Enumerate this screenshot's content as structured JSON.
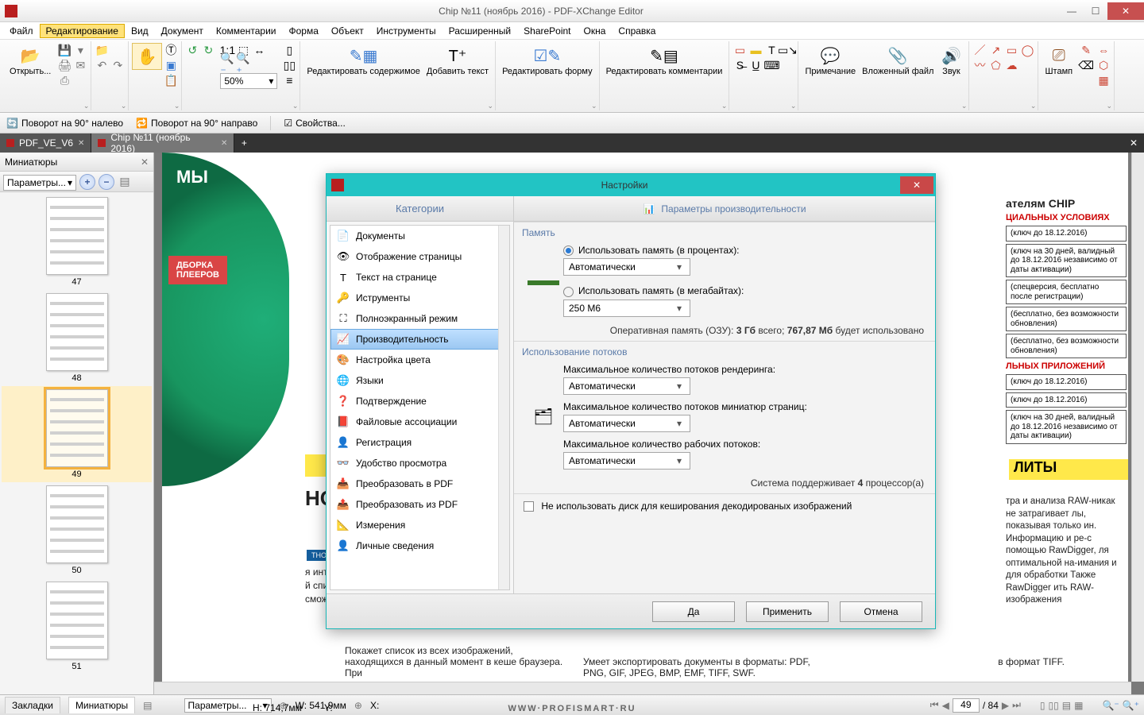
{
  "window": {
    "title": "Chip №11 (ноябрь 2016) - PDF-XChange Editor"
  },
  "menu": [
    "Файл",
    "Редактирование",
    "Вид",
    "Документ",
    "Комментарии",
    "Форма",
    "Объект",
    "Инструменты",
    "Расширенный",
    "SharePoint",
    "Окна",
    "Справка"
  ],
  "menu_active": 1,
  "ribbon": {
    "open": "Открыть...",
    "zoom": "50%",
    "edit_content": "Редактировать содержимое",
    "add_text": "Добавить текст",
    "edit_form": "Редактировать форму",
    "edit_comments": "Редактировать комментарии",
    "note": "Примечание",
    "attach": "Вложенный файл",
    "sound": "Звук",
    "stamp": "Штамп"
  },
  "toolbar2": {
    "rotate_left": "Поворот на 90° налево",
    "rotate_right": "Поворот на 90° направо",
    "properties": "Свойства..."
  },
  "tabs": [
    {
      "label": "PDF_VE_V6"
    },
    {
      "label": "Chip №11 (ноябрь 2016)"
    }
  ],
  "active_tab": 1,
  "thumbs": {
    "title": "Миниатюры",
    "params": "Параметры...",
    "pages": [
      "47",
      "48",
      "49",
      "50",
      "51"
    ],
    "selected": "49"
  },
  "page_content": {
    "chip_readers": "ателям CHIP",
    "special": "ЦИАЛЬНЫХ УСЛОВИЯХ",
    "boxes": [
      "(ключ до 18.12.2016)",
      "(ключ на 30 дней, валидный до 18.12.2016 независимо от даты активации)",
      "(спецверсия, бесплатно после регистрации)",
      "(бесплатно, без возможности обновления)",
      "(бесплатно, без возможности обновления)"
    ],
    "apps": "ЛЬНЫХ ПРИЛОЖЕНИЙ",
    "boxes2": [
      "(ключ до 18.12.2016)",
      "(ключ до 18.12.2016)",
      "(ключ на 30 дней, валидный до 18.12.2016 независимо от даты активации)"
    ],
    "lity": "ЛИТЫ",
    "body1": "тра и анализа RAW-никак не затрагивает лы, показывая только ин. Информацию и ре-с помощью RawDigger, ля оптимальной на-имания и для обработки Также RawDigger ить RAW-изображения",
    "body2": "в формат TIFF.",
    "bottom1": "Покажет список из всех изображений, находящихся в данный момент в кеше браузера. При",
    "bottom2": "Умеет экспортировать документы в форматы: PDF, PNG, GIF, JPEG, BMP, EMF, TIFF, SWF.",
    "left1": "я интернет-радио.",
    "left2": "й список транс-орого вы сможете",
    "green1": "МЫ",
    "green2": "ДБОРКА\nПЛЕЕРОВ",
    "no_label": "НО",
    "tno": "ТНО"
  },
  "dialog": {
    "title": "Настройки",
    "cat_head": "Категории",
    "opt_head": "Параметры производительности",
    "categories": [
      "Документы",
      "Отображение страницы",
      "Текст на странице",
      "Иструменты",
      "Полноэкранный режим",
      "Производительность",
      "Настройка цвета",
      "Языки",
      "Подтверждение",
      "Файловые ассоциации",
      "Регистрация",
      "Удобство просмотра",
      "Преобразовать в PDF",
      "Преобразовать из PDF",
      "Измерения",
      "Личные сведения"
    ],
    "cat_selected": 5,
    "memory": {
      "header": "Память",
      "radio_percent": "Использовать память (в процентах):",
      "percent_value": "Автоматически",
      "radio_mb": "Использовать память (в мегабайтах):",
      "mb_value": "250 М6",
      "ram_note_a": "Оперативная память (ОЗУ): ",
      "ram_total": "3 Гб",
      "ram_note_b": " всего; ",
      "ram_used": "767,87 Мб",
      "ram_note_c": " будет использовано"
    },
    "threads": {
      "header": "Использование потоков",
      "render": "Максимальное количество потоков рендеринга:",
      "render_value": "Автоматически",
      "thumb": "Максимальное количество потоков миниатюр страниц:",
      "thumb_value": "Автоматически",
      "work": "Максимальное количество рабочих потоков:",
      "work_value": "Автоматически",
      "cpu_note_a": "Система поддерживает ",
      "cpu_count": "4",
      "cpu_note_b": " процессор(а)"
    },
    "disk_cache": "Не использовать диск для кеширования декодированых изображений",
    "buttons": {
      "ok": "Да",
      "apply": "Применить",
      "cancel": "Отмена"
    }
  },
  "status": {
    "tab_bookmarks": "Закладки",
    "tab_thumbs": "Миниатюры",
    "params": "Параметры...",
    "w_label": "W:",
    "w": "541,9мм",
    "h_label": "H:",
    "h": "714,7мм",
    "x_label": "X:",
    "y_label": "Y:",
    "page": "49",
    "pages": "84",
    "watermark": "WWW·PROFISMART·RU"
  }
}
